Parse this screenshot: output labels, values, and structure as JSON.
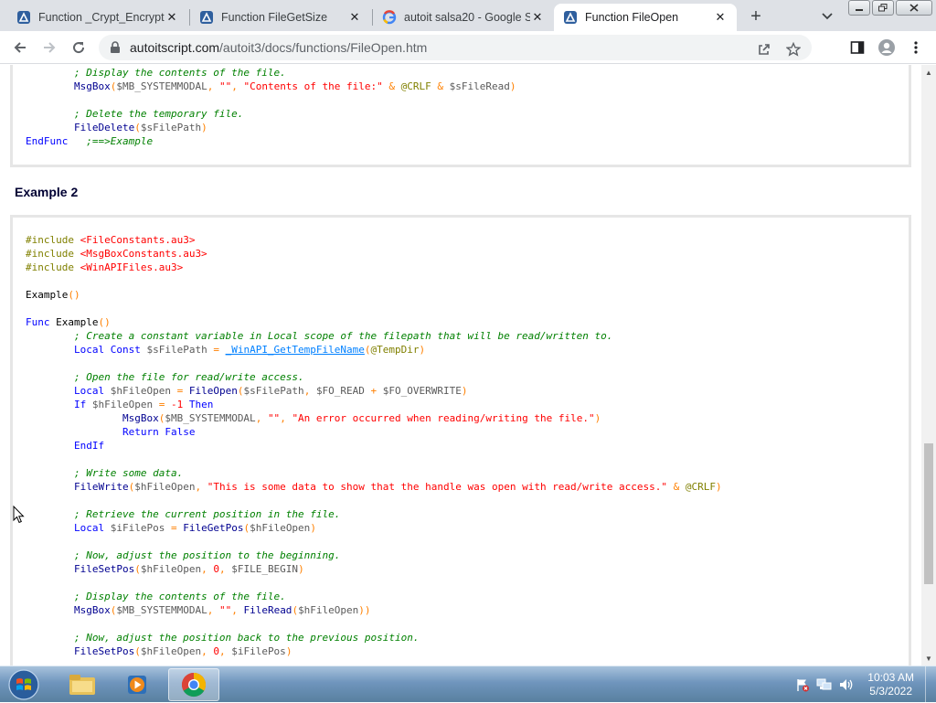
{
  "tabs": [
    {
      "title": "Function _Crypt_EncryptD",
      "active": false
    },
    {
      "title": "Function FileGetSize",
      "active": false
    },
    {
      "title": "autoit salsa20 - Google S",
      "active": false
    },
    {
      "title": "Function FileOpen",
      "active": true
    }
  ],
  "tab_close_glyph": "✕",
  "new_tab_glyph": "+",
  "address": {
    "domain": "autoitscript.com",
    "path": "/autoit3/docs/functions/FileOpen.htm"
  },
  "section_heading": "Example 2",
  "code_top": [
    [
      [
        "cmt",
        "        ; Display the contents of the file."
      ]
    ],
    [
      [
        "plain",
        "        "
      ],
      [
        "fn",
        "MsgBox"
      ],
      [
        "op",
        "("
      ],
      [
        "var",
        "$MB_SYSTEMMODAL"
      ],
      [
        "op",
        ", "
      ],
      [
        "str",
        "\"\""
      ],
      [
        "op",
        ", "
      ],
      [
        "str",
        "\"Contents of the file:\""
      ],
      [
        "op",
        " & "
      ],
      [
        "macro",
        "@CRLF"
      ],
      [
        "op",
        " & "
      ],
      [
        "var",
        "$sFileRead"
      ],
      [
        "op",
        ")"
      ]
    ],
    [
      [
        "plain",
        ""
      ]
    ],
    [
      [
        "cmt",
        "        ; Delete the temporary file."
      ]
    ],
    [
      [
        "plain",
        "        "
      ],
      [
        "fn",
        "FileDelete"
      ],
      [
        "op",
        "("
      ],
      [
        "var",
        "$sFilePath"
      ],
      [
        "op",
        ")"
      ]
    ],
    [
      [
        "kw",
        "EndFunc"
      ],
      [
        "plain",
        "   "
      ],
      [
        "cmt",
        ";==>Example"
      ]
    ]
  ],
  "code_main": [
    [
      [
        "pre",
        "#include "
      ],
      [
        "str",
        "<FileConstants.au3>"
      ]
    ],
    [
      [
        "pre",
        "#include "
      ],
      [
        "str",
        "<MsgBoxConstants.au3>"
      ]
    ],
    [
      [
        "pre",
        "#include "
      ],
      [
        "str",
        "<WinAPIFiles.au3>"
      ]
    ],
    [
      [
        "plain",
        ""
      ]
    ],
    [
      [
        "plain",
        "Example"
      ],
      [
        "op",
        "()"
      ]
    ],
    [
      [
        "plain",
        ""
      ]
    ],
    [
      [
        "kw",
        "Func "
      ],
      [
        "plain",
        "Example"
      ],
      [
        "op",
        "()"
      ]
    ],
    [
      [
        "cmt",
        "        ; Create a constant variable in Local scope of the filepath that will be read/written to."
      ]
    ],
    [
      [
        "plain",
        "        "
      ],
      [
        "kw",
        "Local Const "
      ],
      [
        "var",
        "$sFilePath"
      ],
      [
        "op",
        " = "
      ],
      [
        "udf",
        "_WinAPI_GetTempFileName"
      ],
      [
        "op",
        "("
      ],
      [
        "macro",
        "@TempDir"
      ],
      [
        "op",
        ")"
      ]
    ],
    [
      [
        "plain",
        ""
      ]
    ],
    [
      [
        "cmt",
        "        ; Open the file for read/write access."
      ]
    ],
    [
      [
        "plain",
        "        "
      ],
      [
        "kw",
        "Local "
      ],
      [
        "var",
        "$hFileOpen"
      ],
      [
        "op",
        " = "
      ],
      [
        "fn",
        "FileOpen"
      ],
      [
        "op",
        "("
      ],
      [
        "var",
        "$sFilePath"
      ],
      [
        "op",
        ", "
      ],
      [
        "var",
        "$FO_READ"
      ],
      [
        "op",
        " + "
      ],
      [
        "var",
        "$FO_OVERWRITE"
      ],
      [
        "op",
        ")"
      ]
    ],
    [
      [
        "plain",
        "        "
      ],
      [
        "kw",
        "If "
      ],
      [
        "var",
        "$hFileOpen"
      ],
      [
        "op",
        " = "
      ],
      [
        "num",
        "-1"
      ],
      [
        "kw",
        " Then"
      ]
    ],
    [
      [
        "plain",
        "                "
      ],
      [
        "fn",
        "MsgBox"
      ],
      [
        "op",
        "("
      ],
      [
        "var",
        "$MB_SYSTEMMODAL"
      ],
      [
        "op",
        ", "
      ],
      [
        "str",
        "\"\""
      ],
      [
        "op",
        ", "
      ],
      [
        "str",
        "\"An error occurred when reading/writing the file.\""
      ],
      [
        "op",
        ")"
      ]
    ],
    [
      [
        "plain",
        "                "
      ],
      [
        "kw",
        "Return False"
      ]
    ],
    [
      [
        "plain",
        "        "
      ],
      [
        "kw",
        "EndIf"
      ]
    ],
    [
      [
        "plain",
        ""
      ]
    ],
    [
      [
        "cmt",
        "        ; Write some data."
      ]
    ],
    [
      [
        "plain",
        "        "
      ],
      [
        "fn",
        "FileWrite"
      ],
      [
        "op",
        "("
      ],
      [
        "var",
        "$hFileOpen"
      ],
      [
        "op",
        ", "
      ],
      [
        "str",
        "\"This is some data to show that the handle was open with read/write access.\""
      ],
      [
        "op",
        " & "
      ],
      [
        "macro",
        "@CRLF"
      ],
      [
        "op",
        ")"
      ]
    ],
    [
      [
        "plain",
        ""
      ]
    ],
    [
      [
        "cmt",
        "        ; Retrieve the current position in the file."
      ]
    ],
    [
      [
        "plain",
        "        "
      ],
      [
        "kw",
        "Local "
      ],
      [
        "var",
        "$iFilePos"
      ],
      [
        "op",
        " = "
      ],
      [
        "fn",
        "FileGetPos"
      ],
      [
        "op",
        "("
      ],
      [
        "var",
        "$hFileOpen"
      ],
      [
        "op",
        ")"
      ]
    ],
    [
      [
        "plain",
        ""
      ]
    ],
    [
      [
        "cmt",
        "        ; Now, adjust the position to the beginning."
      ]
    ],
    [
      [
        "plain",
        "        "
      ],
      [
        "fn",
        "FileSetPos"
      ],
      [
        "op",
        "("
      ],
      [
        "var",
        "$hFileOpen"
      ],
      [
        "op",
        ", "
      ],
      [
        "num",
        "0"
      ],
      [
        "op",
        ", "
      ],
      [
        "var",
        "$FILE_BEGIN"
      ],
      [
        "op",
        ")"
      ]
    ],
    [
      [
        "plain",
        ""
      ]
    ],
    [
      [
        "cmt",
        "        ; Display the contents of the file."
      ]
    ],
    [
      [
        "plain",
        "        "
      ],
      [
        "fn",
        "MsgBox"
      ],
      [
        "op",
        "("
      ],
      [
        "var",
        "$MB_SYSTEMMODAL"
      ],
      [
        "op",
        ", "
      ],
      [
        "str",
        "\"\""
      ],
      [
        "op",
        ", "
      ],
      [
        "fn",
        "FileRead"
      ],
      [
        "op",
        "("
      ],
      [
        "var",
        "$hFileOpen"
      ],
      [
        "op",
        "))"
      ]
    ],
    [
      [
        "plain",
        ""
      ]
    ],
    [
      [
        "cmt",
        "        ; Now, adjust the position back to the previous position."
      ]
    ],
    [
      [
        "plain",
        "        "
      ],
      [
        "fn",
        "FileSetPos"
      ],
      [
        "op",
        "("
      ],
      [
        "var",
        "$hFileOpen"
      ],
      [
        "op",
        ", "
      ],
      [
        "num",
        "0"
      ],
      [
        "op",
        ", "
      ],
      [
        "var",
        "$iFilePos"
      ],
      [
        "op",
        ")"
      ]
    ]
  ],
  "clock": {
    "time": "10:03 AM",
    "date": "5/3/2022"
  },
  "icons": {
    "back": "back-arrow-icon",
    "forward": "forward-arrow-icon",
    "reload": "reload-icon",
    "lock": "lock-icon",
    "share": "share-icon",
    "star": "bookmark-star-icon",
    "sidepanel": "side-panel-icon",
    "profile": "profile-avatar-icon",
    "menu": "kebab-menu-icon"
  }
}
